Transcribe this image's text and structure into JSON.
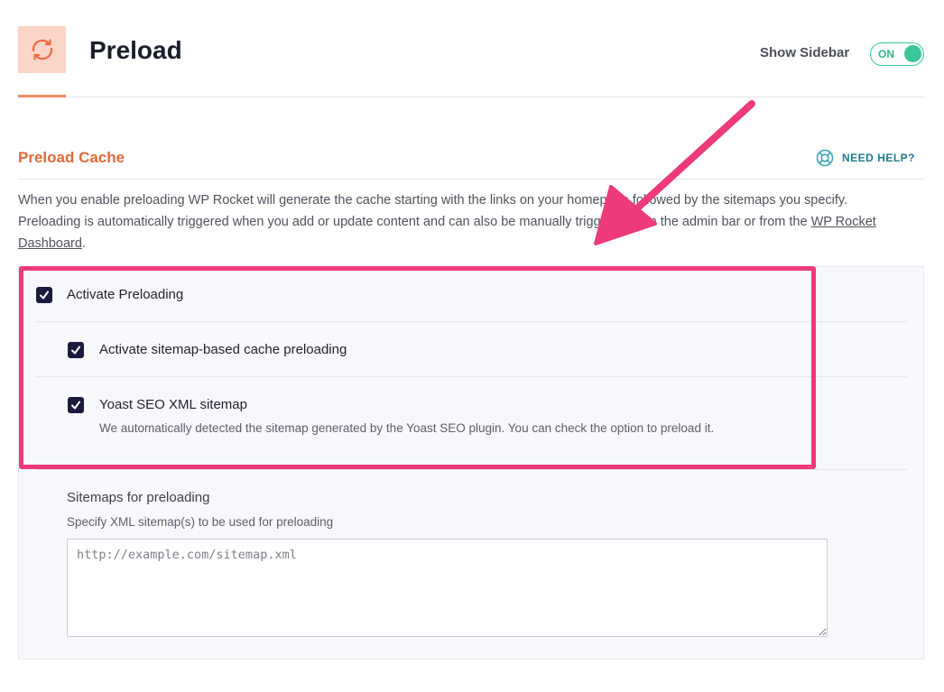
{
  "header": {
    "title": "Preload",
    "show_sidebar_label": "Show Sidebar",
    "toggle_label": "ON",
    "icon": "refresh-icon"
  },
  "section": {
    "title": "Preload Cache",
    "help_label": "NEED HELP?",
    "help_icon": "lifebuoy-icon",
    "description_line1": "When you enable preloading WP Rocket will generate the cache starting with the links on your homepage followed by the sitemaps you specify.",
    "description_line2": "Preloading is automatically triggered when you add or update content and can also be manually triggered from the admin bar or from the ",
    "description_link": "WP Rocket Dashboard",
    "description_end": "."
  },
  "options": {
    "activate_preloading": {
      "label": "Activate Preloading",
      "checked": true
    },
    "sitemap_preloading": {
      "label": "Activate sitemap-based cache preloading",
      "checked": true
    },
    "yoast_sitemap": {
      "label": "Yoast SEO XML sitemap",
      "description": "We automatically detected the sitemap generated by the Yoast SEO plugin. You can check the option to preload it.",
      "checked": true
    }
  },
  "sitemaps_field": {
    "title": "Sitemaps for preloading",
    "subtitle": "Specify XML sitemap(s) to be used for preloading",
    "placeholder": "http://example.com/sitemap.xml",
    "value": ""
  },
  "colors": {
    "accent_orange": "#e2673b",
    "toggle_green": "#3ac59a",
    "checkbox_navy": "#1c1a3e",
    "annotation_pink": "#ec3a7a",
    "help_teal": "#1f7a8c"
  }
}
